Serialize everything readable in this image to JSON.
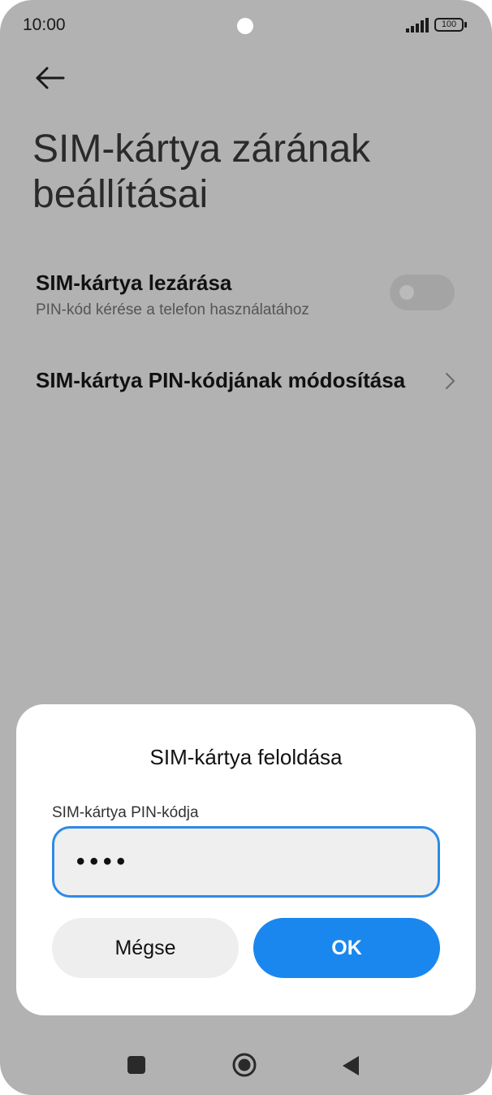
{
  "status_bar": {
    "time": "10:00",
    "battery": "100",
    "icons": [
      "signal-icon",
      "battery-icon"
    ]
  },
  "header": {
    "back_icon": "arrow-left-icon",
    "title": "SIM-kártya zárának beállításai"
  },
  "settings": {
    "lock_sim": {
      "title": "SIM-kártya lezárása",
      "subtitle": "PIN-kód kérése a telefon használatához",
      "enabled": false
    },
    "change_pin": {
      "title": "SIM-kártya PIN-kódjának módosítása",
      "icon": "chevron-right-icon"
    }
  },
  "dialog": {
    "title": "SIM-kártya feloldása",
    "field_label": "SIM-kártya PIN-kódja",
    "pin_masked": "••••",
    "cancel_label": "Mégse",
    "ok_label": "OK",
    "accent_color": "#1a87ef"
  },
  "nav_bar": {
    "icons": [
      "recents-square-icon",
      "home-circle-icon",
      "back-triangle-icon"
    ]
  }
}
